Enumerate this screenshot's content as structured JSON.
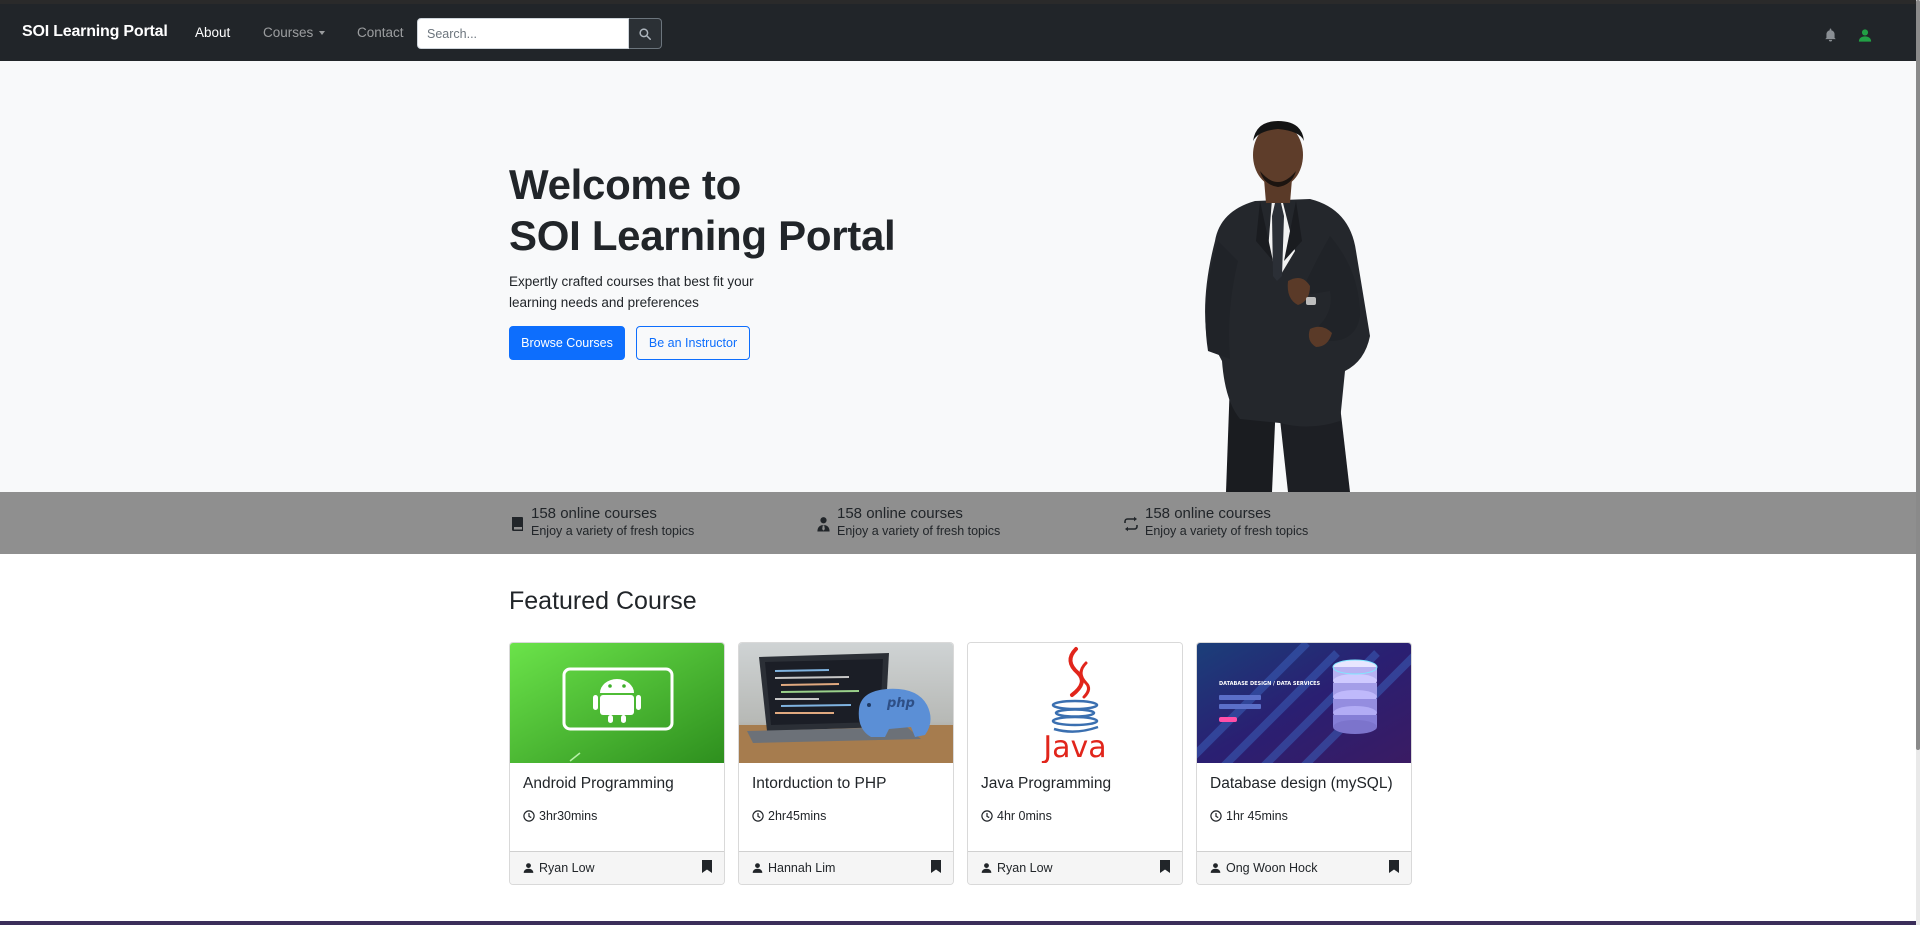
{
  "navbar": {
    "brand": "SOI Learning Portal",
    "links": [
      {
        "label": "About"
      },
      {
        "label": "Courses"
      },
      {
        "label": "Contact"
      }
    ],
    "search_placeholder": "Search...",
    "icons": [
      "search-icon",
      "bell-icon",
      "user-icon"
    ],
    "user_icon_color": "#22a045"
  },
  "hero": {
    "title_line1": "Welcome to",
    "title_line2": "SOI Learning Portal",
    "subtitle": "Expertly crafted courses that best fit your learning needs and preferences",
    "primary_button": "Browse Courses",
    "secondary_button": "Be an Instructor",
    "background": "#f8f9fa"
  },
  "stats": [
    {
      "icon": "book-icon",
      "title": "158 online courses",
      "desc": "Enjoy a variety of fresh topics"
    },
    {
      "icon": "instructor-icon",
      "title": "158 online courses",
      "desc": "Enjoy a variety of fresh topics"
    },
    {
      "icon": "repeat-icon",
      "title": "158 online courses",
      "desc": "Enjoy a variety of fresh topics"
    }
  ],
  "featured": {
    "heading": "Featured Course",
    "courses": [
      {
        "title": "Android Programming",
        "duration": "3hr30mins",
        "author": "Ryan Low",
        "image": "android-logo"
      },
      {
        "title": "Intorduction to PHP",
        "duration": "2hr45mins",
        "author": "Hannah Lim",
        "image": "php-elephant-laptop"
      },
      {
        "title": "Java Programming",
        "duration": "4hr 0mins",
        "author": "Ryan Low",
        "image": "java-logo"
      },
      {
        "title": "Database design (mySQL)",
        "duration": "1hr 45mins",
        "author": "Ong Woon Hock",
        "image": "database-illustration"
      }
    ]
  },
  "colors": {
    "navbar": "#212529",
    "primary": "#0d6efd",
    "stats_bar": "#8f8f8f"
  },
  "java_logo_text": "Java",
  "php_logo_text": "php",
  "db_image_text": "DATABASE DESIGN / DATA SERVICES"
}
